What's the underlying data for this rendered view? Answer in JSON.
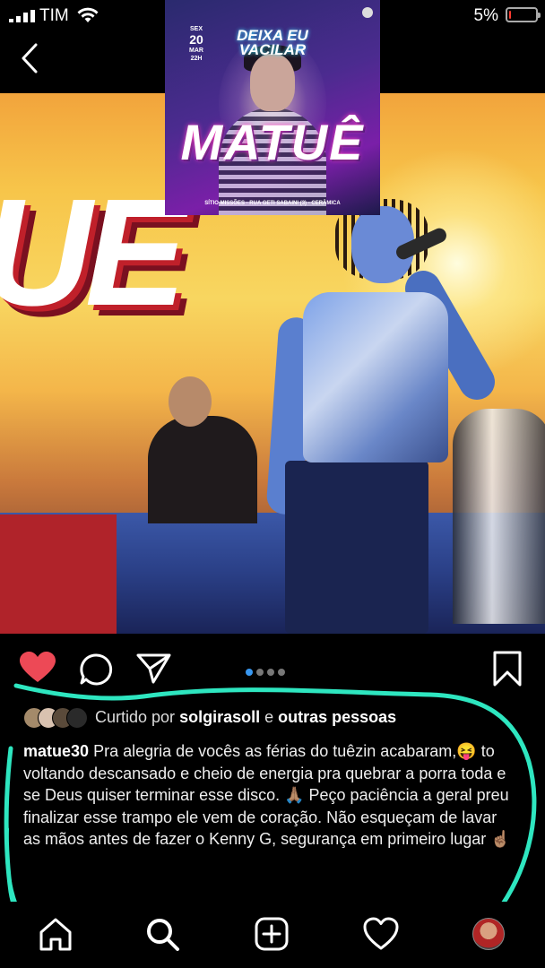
{
  "status_bar": {
    "carrier": "TIM",
    "battery_percent_label": "5%",
    "battery_level": 0.05,
    "battery_color": "#ff3b30"
  },
  "navigation": {
    "back_icon": "chevron-left-icon"
  },
  "flyer": {
    "date_weekday": "SEX",
    "date_day": "20",
    "date_month": "MAR",
    "date_time": "22H",
    "title_line1": "DEIXA EU",
    "title_line2": "VACILAR",
    "artist": "MATUÊ",
    "footer": "SÍTIO MISSÕES · RUA GETI SABAINI (3) - CERÂMICA"
  },
  "photo": {
    "screen_text": "UE",
    "description_icon": "concert-photo"
  },
  "actions": {
    "like_icon": "heart-filled-icon",
    "comment_icon": "comment-icon",
    "share_icon": "paper-plane-icon",
    "save_icon": "bookmark-icon",
    "like_color": "#ed4956",
    "carousel_total": 4,
    "carousel_active": 1,
    "carousel_active_color": "#3897f0"
  },
  "likes": {
    "prefix": "Curtido por",
    "user": "solgirasoll",
    "connector": "e",
    "others": "outras pessoas"
  },
  "caption": {
    "username": "matue30",
    "text": "Pra alegria de vocês as férias do tuêzin acabaram,😝 to voltando descansado e cheio de energia pra quebrar a porra toda e se Deus quiser terminar esse disco. 🙏🏽 Peço paciência a geral preu finalizar esse trampo ele vem de coração. Não esqueçam de lavar as mãos antes de fazer o Kenny G, segurança em primeiro lugar ☝🏽"
  },
  "annotation": {
    "color": "#2ee6c0"
  },
  "tab_bar": {
    "home_icon": "home-icon",
    "search_icon": "search-icon",
    "new_post_icon": "plus-square-icon",
    "activity_icon": "heart-icon",
    "profile_icon": "profile-avatar"
  }
}
